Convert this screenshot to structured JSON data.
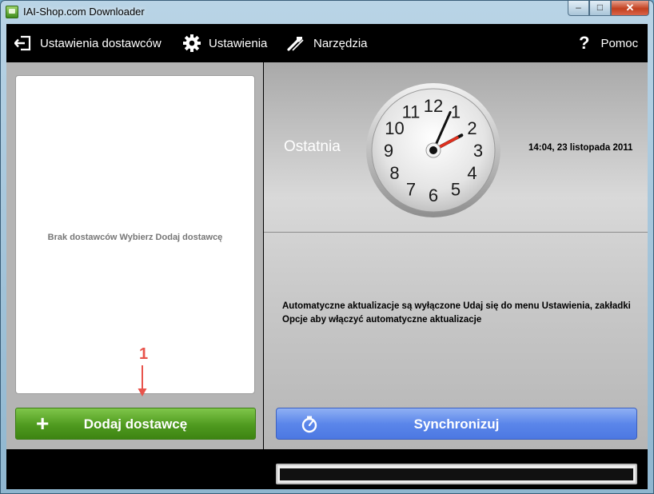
{
  "window": {
    "title": "IAI-Shop.com Downloader"
  },
  "window_controls": {
    "minimize": "–",
    "maximize": "□",
    "close": "✕"
  },
  "menu": {
    "supplier_settings": "Ustawienia dostawców",
    "settings": "Ustawienia",
    "tools": "Narzędzia",
    "help": "Pomoc"
  },
  "suppliers": {
    "empty_message": "Brak dostawców Wybierz Dodaj dostawcę",
    "add_button": "Dodaj dostawcę"
  },
  "annotation": {
    "number": "1",
    "color": "#e8544c"
  },
  "last_sync": {
    "label": "Ostatnia",
    "datetime": "14:04, 23 listopada 2011",
    "clock": {
      "numbers": [
        "12",
        "1",
        "2",
        "3",
        "4",
        "5",
        "6",
        "7",
        "8",
        "9",
        "10",
        "11"
      ],
      "hour": 2,
      "minute": 4
    }
  },
  "auto_update_info": "Automatyczne aktualizacje są wyłączone Udaj się do menu Ustawienia, zakładki Opcje aby włączyć automatyczne aktualizacje",
  "sync": {
    "button": "Synchronizuj"
  },
  "progress": {
    "value": 0
  },
  "colors": {
    "add_button": "#4f9a1f",
    "sync_button": "#5b86ea",
    "clock_hand_second": "#e0301e"
  }
}
